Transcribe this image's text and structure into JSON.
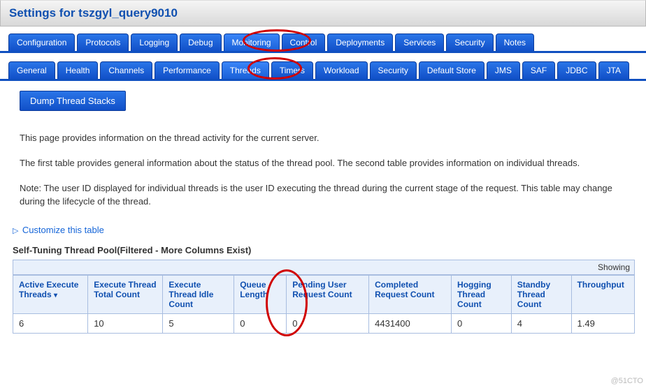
{
  "page_title": "Settings for tszgyl_query9010",
  "main_tabs": [
    {
      "label": "Configuration"
    },
    {
      "label": "Protocols"
    },
    {
      "label": "Logging"
    },
    {
      "label": "Debug"
    },
    {
      "label": "Monitoring",
      "active": true
    },
    {
      "label": "Control"
    },
    {
      "label": "Deployments"
    },
    {
      "label": "Services"
    },
    {
      "label": "Security"
    },
    {
      "label": "Notes"
    }
  ],
  "sub_tabs": [
    {
      "label": "General"
    },
    {
      "label": "Health"
    },
    {
      "label": "Channels"
    },
    {
      "label": "Performance"
    },
    {
      "label": "Threads",
      "active": true
    },
    {
      "label": "Timers"
    },
    {
      "label": "Workload"
    },
    {
      "label": "Security"
    },
    {
      "label": "Default Store"
    },
    {
      "label": "JMS"
    },
    {
      "label": "SAF"
    },
    {
      "label": "JDBC"
    },
    {
      "label": "JTA"
    }
  ],
  "dump_button": "Dump Thread Stacks",
  "description": {
    "p1": "This page provides information on the thread activity for the current server.",
    "p2": "The first table provides general information about the status of the thread pool. The second table provides information on individual threads.",
    "p3": "Note: The user ID displayed for individual threads is the user ID executing the thread during the current stage of the request. This table may change during the lifecycle of the thread."
  },
  "customize_label": "Customize this table",
  "table_title": "Self-Tuning Thread Pool(Filtered - More Columns Exist)",
  "showing_label": "Showing",
  "columns": [
    "Active Execute Threads",
    "Execute Thread Total Count",
    "Execute Thread Idle Count",
    "Queue Length",
    "Pending User Request Count",
    "Completed Request Count",
    "Hogging Thread Count",
    "Standby Thread Count",
    "Throughput"
  ],
  "row": {
    "active_execute_threads": "6",
    "execute_thread_total_count": "10",
    "execute_thread_idle_count": "5",
    "queue_length": "0",
    "pending_user_request_count": "0",
    "completed_request_count": "4431400",
    "hogging_thread_count": "0",
    "standby_thread_count": "4",
    "throughput": "1.49"
  },
  "watermark": "@51CTO"
}
